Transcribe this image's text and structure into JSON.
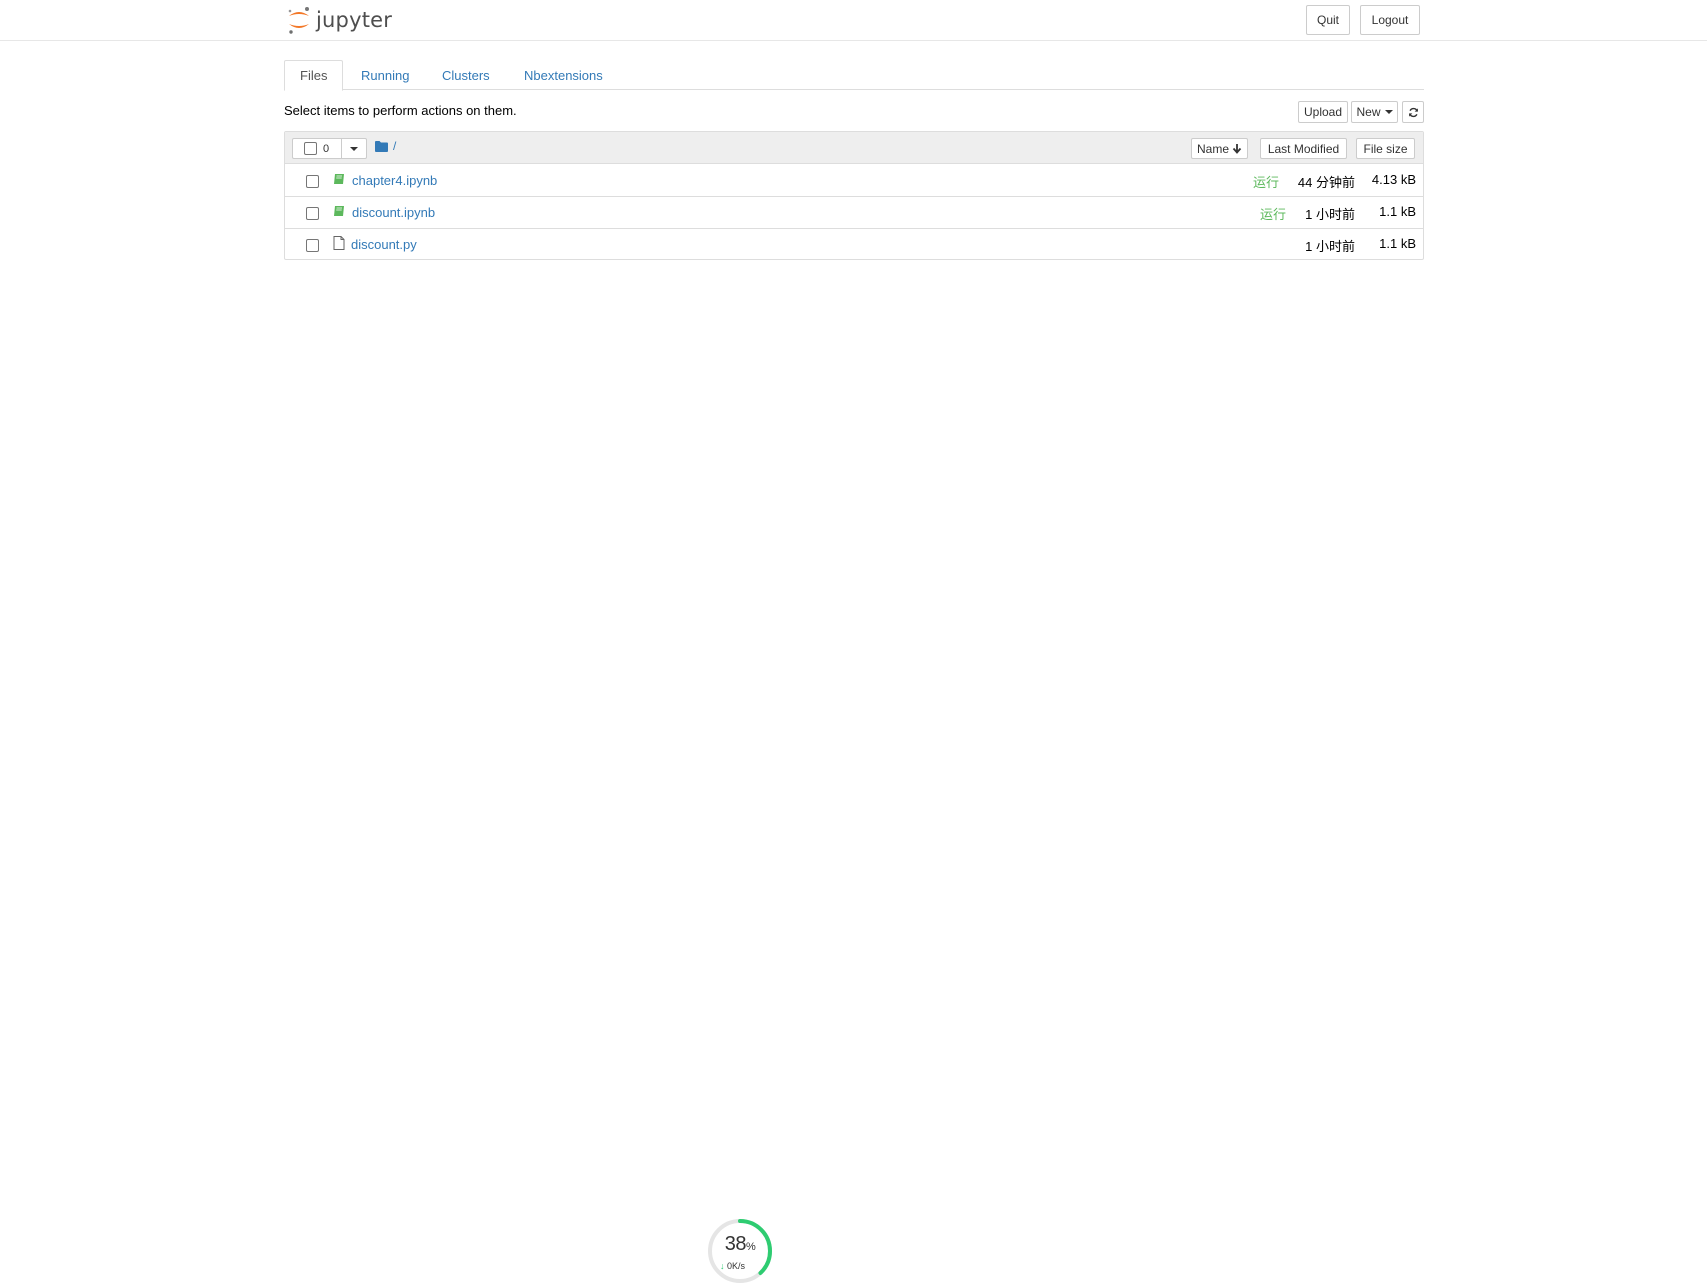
{
  "header": {
    "logo_text": "jupyter",
    "quit_label": "Quit",
    "logout_label": "Logout"
  },
  "tabs": [
    {
      "label": "Files",
      "active": true
    },
    {
      "label": "Running",
      "active": false
    },
    {
      "label": "Clusters",
      "active": false
    },
    {
      "label": "Nbextensions",
      "active": false
    }
  ],
  "toolbar": {
    "hint": "Select items to perform actions on them.",
    "upload_label": "Upload",
    "new_label": "New",
    "refresh_icon": "refresh-icon"
  },
  "list_header": {
    "selected_count": "0",
    "breadcrumb_root": "/",
    "sort_name_label": "Name",
    "sort_modified_label": "Last Modified",
    "sort_size_label": "File size"
  },
  "files": [
    {
      "name": "chapter4.ipynb",
      "icon": "notebook-icon",
      "running": "运行",
      "modified": "44 分钟前",
      "size": "4.13 kB"
    },
    {
      "name": "discount.ipynb",
      "icon": "notebook-icon",
      "running": "运行",
      "modified": "1 小时前",
      "size": "1.1 kB"
    },
    {
      "name": "discount.py",
      "icon": "file-icon",
      "running": "",
      "modified": "1 小时前",
      "size": "1.1 kB"
    }
  ],
  "net_widget": {
    "percent": "38",
    "percent_sign": "%",
    "speed": "0K/s"
  },
  "colors": {
    "link": "#337ab7",
    "running": "#5cb85c",
    "notebook_icon": "#5cb85c",
    "jupyter_orange": "#f37726",
    "widget_ring": "#2ecc71"
  }
}
